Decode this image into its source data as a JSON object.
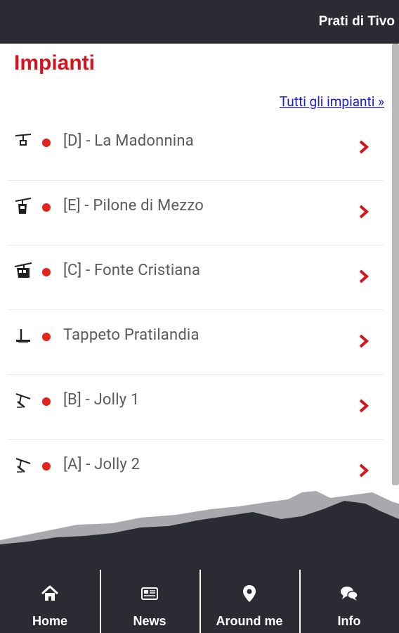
{
  "header": {
    "title": "Prati di Tivo"
  },
  "section": {
    "title": "Impianti",
    "all_link": "Tutti gli impianti »"
  },
  "colors": {
    "accent": "#d7141c",
    "status_open": "#e2231a",
    "bar": "#2b2b33",
    "link": "#1a1adb"
  },
  "lifts": [
    {
      "name": "[D] - La Madonnina",
      "icon": "chairlift-icon",
      "status": "red"
    },
    {
      "name": "[E] - Pilone di Mezzo",
      "icon": "gondola-icon",
      "status": "red"
    },
    {
      "name": "[C] - Fonte Cristiana",
      "icon": "cablecar-icon",
      "status": "red"
    },
    {
      "name": "Tappeto Pratilandia",
      "icon": "magic-carpet-icon",
      "status": "red"
    },
    {
      "name": "[B] - Jolly 1",
      "icon": "skilift-icon",
      "status": "red"
    },
    {
      "name": "[A] - Jolly 2",
      "icon": "skilift-icon",
      "status": "red"
    }
  ],
  "nav": [
    {
      "label": "Home",
      "icon": "home-icon"
    },
    {
      "label": "News",
      "icon": "newspaper-icon"
    },
    {
      "label": "Around me",
      "icon": "map-pin-icon"
    },
    {
      "label": "Info",
      "icon": "chat-bubbles-icon"
    }
  ]
}
